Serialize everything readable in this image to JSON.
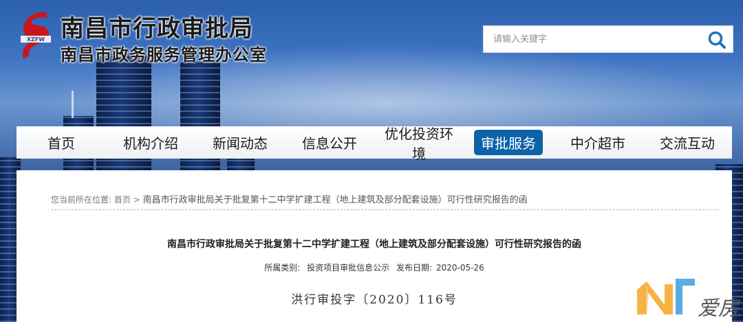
{
  "header": {
    "logo_text": "XZFW",
    "title_main": "南昌市行政审批局",
    "title_sub": "南昌市政务服务管理办公室"
  },
  "search": {
    "placeholder": "请输入关键字",
    "icon": "search-icon"
  },
  "nav": {
    "items": [
      {
        "label": "首页"
      },
      {
        "label": "机构介绍"
      },
      {
        "label": "新闻动态"
      },
      {
        "label": "信息公开"
      },
      {
        "label": "优化投资环境"
      },
      {
        "label": "审批服务",
        "active": true
      },
      {
        "label": "中介超市"
      },
      {
        "label": "交流互动"
      }
    ],
    "active_color": "#0b62a8"
  },
  "breadcrumb": {
    "prefix": "您当前所在位置:",
    "home": "首页",
    "separator": ">",
    "current": "南昌市行政审批局关于批复第十二中学扩建工程（地上建筑及部分配套设施）可行性研究报告的函"
  },
  "article": {
    "title": "南昌市行政审批局关于批复第十二中学扩建工程（地上建筑及部分配套设施）可行性研究报告的函",
    "category_label": "所属类别:",
    "category": "投资项目审批信息公示",
    "date_label": "发布日期:",
    "date": "2020-05-26",
    "doc_number": "洪行审投字〔2020〕116号"
  },
  "watermark": {
    "text": "爱房"
  }
}
